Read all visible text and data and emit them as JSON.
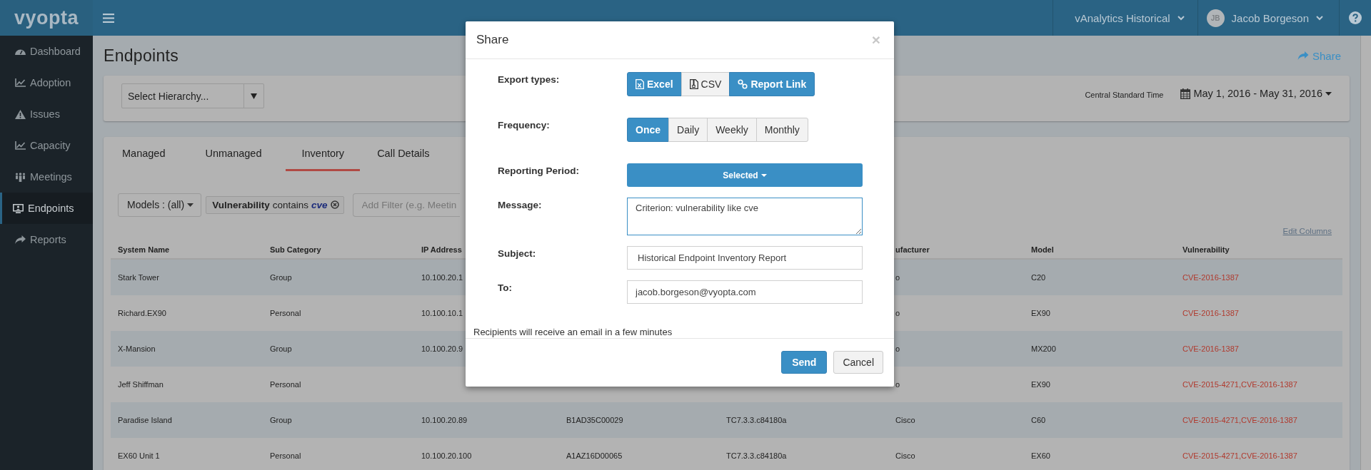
{
  "topbar": {
    "logo": "vyopta",
    "app_switcher": "vAnalytics Historical",
    "user": {
      "initials": "JB",
      "name": "Jacob Borgeson"
    }
  },
  "sidebar": {
    "items": [
      {
        "label": "Dashboard",
        "kind": "gauge",
        "selected": false
      },
      {
        "label": "Adoption",
        "kind": "chart",
        "selected": false
      },
      {
        "label": "Issues",
        "kind": "warning",
        "selected": false
      },
      {
        "label": "Capacity",
        "kind": "chart",
        "selected": false
      },
      {
        "label": "Meetings",
        "kind": "people",
        "selected": false
      },
      {
        "label": "Endpoints",
        "kind": "monitor",
        "selected": true
      },
      {
        "label": "Reports",
        "kind": "share",
        "selected": false
      }
    ]
  },
  "page": {
    "title": "Endpoints",
    "share": "Share",
    "hierarchy_placeholder": "Select Hierarchy...",
    "timezone": "Central Standard Time",
    "date_range": "May 1, 2016 - May 31, 2016"
  },
  "tabs": [
    {
      "label": "Managed",
      "selected": false
    },
    {
      "label": "Unmanaged",
      "selected": false
    },
    {
      "label": "Inventory",
      "selected": true
    },
    {
      "label": "Call Details",
      "selected": false
    }
  ],
  "filters": {
    "models": "Models : (all)",
    "chip": {
      "field": "Vulnerability",
      "operator": "contains",
      "value": "cve"
    },
    "add_filter_placeholder": "Add Filter (e.g. Meetin"
  },
  "edit_columns": "Edit Columns",
  "table": {
    "columns": [
      {
        "label": "System Name"
      },
      {
        "label": "Sub Category"
      },
      {
        "label": "IP Address"
      },
      {},
      {},
      {
        "label": "ufacturer"
      },
      {
        "label": "Model"
      },
      {
        "label": "Vulnerability"
      }
    ],
    "rows": [
      {
        "cells": [
          "Stark Tower",
          "Group",
          "10.100.20.1",
          null,
          null,
          "o",
          "C20",
          "CVE-2016-1387"
        ]
      },
      {
        "cells": [
          "Richard.EX90",
          "Personal",
          "10.100.10.1",
          null,
          null,
          "o",
          "EX90",
          "CVE-2016-1387"
        ]
      },
      {
        "cells": [
          "X-Mansion",
          "Group",
          "10.100.20.9",
          null,
          null,
          "o",
          "MX200",
          "CVE-2016-1387"
        ]
      },
      {
        "cells": [
          "Jeff Shiffman",
          "Personal",
          null,
          null,
          null,
          "o",
          "EX90",
          "CVE-2015-4271,CVE-2016-1387"
        ]
      },
      {
        "cells": [
          "Paradise Island",
          "Group",
          "10.100.20.89",
          "B1AD35C00029",
          "TC7.3.3.c84180a",
          "Cisco",
          "C60",
          "CVE-2015-4271,CVE-2016-1387"
        ]
      },
      {
        "cells": [
          "EX60 Unit 1",
          "Personal",
          "10.100.20.100",
          "A1AZ16D00065",
          "TC7.3.3.c84180a",
          "Cisco",
          "EX60",
          "CVE-2015-4271,CVE-2016-1387"
        ]
      }
    ]
  },
  "share_dialog": {
    "title": "Share",
    "close": "×",
    "export_types": {
      "label": "Export types:",
      "options": [
        {
          "label": "Excel",
          "selected": true
        },
        {
          "label": "CSV",
          "selected": false
        },
        {
          "label": "Report Link",
          "selected": true
        }
      ]
    },
    "frequency": {
      "label": "Frequency:",
      "options": [
        {
          "label": "Once",
          "selected": true
        },
        {
          "label": "Daily",
          "selected": false
        },
        {
          "label": "Weekly",
          "selected": false
        },
        {
          "label": "Monthly",
          "selected": false
        }
      ]
    },
    "reporting_period": {
      "label": "Reporting Period:",
      "value": "Selected"
    },
    "message": {
      "label": "Message:",
      "value": "Criterion: vulnerability like cve"
    },
    "subject": {
      "label": "Subject:",
      "value": "Historical Endpoint Inventory Report"
    },
    "to": {
      "label": "To:",
      "value": "jacob.borgeson@vyopta.com"
    },
    "note": "Recipients will receive an email in a few minutes",
    "buttons": [
      {
        "label": "Send",
        "kind": "primary"
      },
      {
        "label": "Cancel",
        "kind": "default"
      }
    ]
  }
}
